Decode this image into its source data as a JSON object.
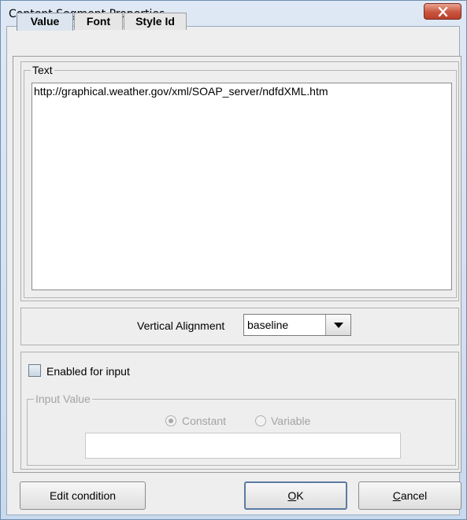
{
  "window": {
    "title": "Content Segment Properties"
  },
  "tabs": [
    {
      "label": "Value",
      "active": true
    },
    {
      "label": "Font",
      "active": false
    },
    {
      "label": "Style Id",
      "active": false
    }
  ],
  "text_group": {
    "legend": "Text",
    "value": "http://graphical.weather.gov/xml/SOAP_server/ndfdXML.htm"
  },
  "alignment": {
    "label": "Vertical Alignment",
    "selected": "baseline"
  },
  "input_section": {
    "checkbox_label": "Enabled for input",
    "checked": false,
    "group_legend": "Input Value",
    "radio_constant": "Constant",
    "radio_variable": "Variable",
    "selected_radio": "Constant",
    "value": ""
  },
  "buttons": {
    "edit_condition": "Edit condition",
    "ok_mnemonic": "O",
    "ok_rest": "K",
    "cancel_mnemonic": "C",
    "cancel_rest": "ancel"
  },
  "icons": {
    "close": "close-icon",
    "dropdown": "chevron-down-icon",
    "checkbox": "checkbox-unchecked-icon"
  }
}
